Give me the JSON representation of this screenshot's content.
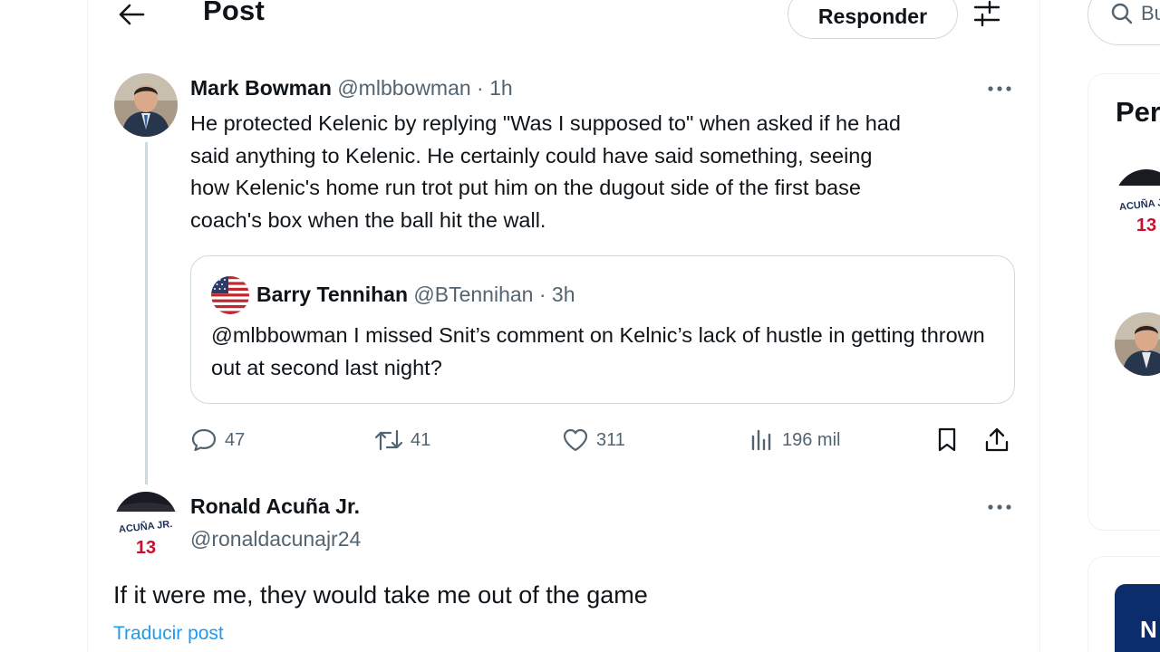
{
  "header": {
    "back_icon": "arrow-left-icon",
    "title": "Post",
    "reply_label": "Responder",
    "filter_icon": "sliders-icon"
  },
  "tweet": {
    "author_name": "Mark Bowman",
    "handle": "@mlbbowman",
    "separator": " · ",
    "time": "1h",
    "body": "He protected Kelenic by replying \"Was I supposed to\" when asked if he had\nsaid anything to Kelenic.  He certainly could have said something, seeing\nhow Kelenic's home run trot put him on the dugout side of the first base\ncoach's box when the ball hit the wall.",
    "quote": {
      "author_name": "Barry Tennihan",
      "handle": "@BTennihan",
      "separator": " · ",
      "time": "3h",
      "body": "@mlbbowman I missed Snit’s comment on Kelnic’s lack of hustle in getting thrown out at second last night?"
    },
    "actions": {
      "replies": "47",
      "reposts": "41",
      "likes": "311",
      "views": "196 mil"
    }
  },
  "reply_tweet": {
    "author_name": "Ronald Acuña Jr.",
    "handle": "@ronaldacunajr24",
    "body": "If it were me, they would take me out of the game",
    "translate_label": "Traducir post"
  },
  "sidebar": {
    "search_placeholder": "Bu",
    "section_title": "Per",
    "tile_letter": "N"
  },
  "colors": {
    "accent": "#1d9bf0",
    "text_primary": "#0f1419",
    "text_secondary": "#536471",
    "border": "#cfd9de"
  }
}
